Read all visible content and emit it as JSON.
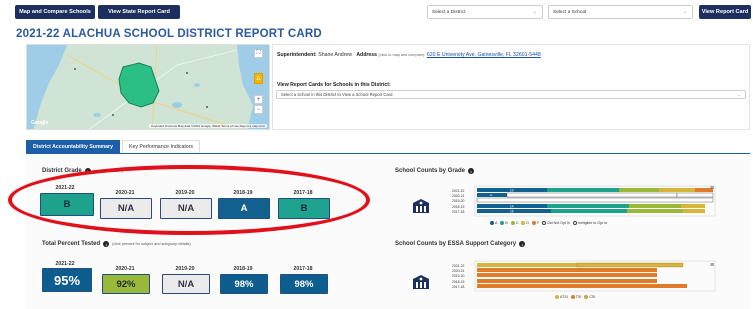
{
  "topbar": {
    "map_compare_label": "Map and Compare Schools",
    "view_state_label": "View State Report Card",
    "district_select_value": "Select a District",
    "school_select_value": "Select a School",
    "view_report_label": "View Report Card"
  },
  "page_title": "2021-22 ALACHUA SCHOOL DISTRICT REPORT CARD",
  "map": {
    "google_label": "Google",
    "attribution": "Keyboard shortcuts   Map data ©2023 Google, INEGI   Terms of Use   Report a map error"
  },
  "info": {
    "superintendent_label": "Superintendent:",
    "superintendent_name": "Shane Andrew",
    "address_label": "Address",
    "address_note": "(click to map and compare):",
    "address_link": "620 E University Ave, Gainesville, FL 32601-5448",
    "view_schools_heading": "View Report Cards for Schools in this District:",
    "school_select_placeholder": "Select a School in this District to View a School Report Card"
  },
  "tabs": [
    {
      "label": "District Accountability Summary",
      "active": true
    },
    {
      "label": "Key Performance Indicators",
      "active": false
    }
  ],
  "district_grade": {
    "heading": "District Grade",
    "note": "(click grade for...)",
    "years": [
      "2021-22",
      "2020-21",
      "2019-20",
      "2018-19",
      "2017-18"
    ],
    "grades": [
      "B",
      "N/A",
      "N/A",
      "A",
      "B"
    ]
  },
  "percent_tested": {
    "heading": "Total Percent Tested",
    "note": "(click percent for subject and subgroup details)",
    "years": [
      "2021-22",
      "2020-21",
      "2019-20",
      "2018-19",
      "2017-18"
    ],
    "values": [
      "95%",
      "92%",
      "N/A",
      "98%",
      "98%"
    ]
  },
  "school_counts_grade": {
    "heading": "School Counts by Grade",
    "rows": [
      "2021-22",
      "2020-21",
      "2019-20",
      "2018-19",
      "2017-18"
    ],
    "legend": [
      "A",
      "B",
      "C",
      "D",
      "F",
      "Did Not Opt In",
      "Ineligible to Opt In"
    ],
    "colors": {
      "A": "#13618f",
      "B": "#1da38b",
      "C": "#9ab938",
      "D": "#d8b53a",
      "F": "#e07b2a",
      "DidNotOptIn": "#ffffff",
      "Ineligible": "#ffffff"
    },
    "labels_2021_22": [
      "13",
      "",
      "",
      "",
      ""
    ],
    "labels_2018_19": [
      "14",
      "",
      "",
      "",
      ""
    ],
    "labels_2017_18": [
      "16",
      "",
      "",
      "",
      ""
    ],
    "labels_2020_21": [
      "4"
    ]
  },
  "school_counts_essa": {
    "heading": "School Counts by ESSA Support Category",
    "rows": [
      "2021-22",
      "2020-21",
      "2019-20",
      "2018-19",
      "2017-18"
    ],
    "legend": [
      "ATSI",
      "TSI",
      "CSI"
    ],
    "colors": {
      "ATSI": "#d8b53a",
      "TSI": "#e07b2a",
      "CSI": "#c9a23a"
    }
  },
  "icons": {
    "menu": "hamburger-menu-icon",
    "info": "info-icon",
    "school": "school-building-icon"
  }
}
